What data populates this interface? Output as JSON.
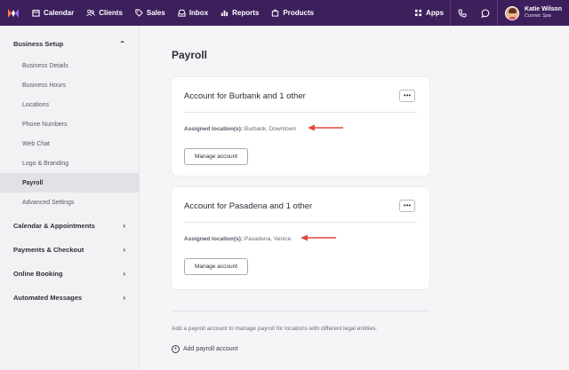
{
  "nav": {
    "items": [
      {
        "label": "Calendar",
        "icon": "calendar-icon"
      },
      {
        "label": "Clients",
        "icon": "users-icon"
      },
      {
        "label": "Sales",
        "icon": "tag-icon"
      },
      {
        "label": "Inbox",
        "icon": "inbox-icon"
      },
      {
        "label": "Reports",
        "icon": "bar-chart-icon"
      },
      {
        "label": "Products",
        "icon": "bag-icon"
      }
    ],
    "apps_label": "Apps",
    "user": {
      "name": "Katie Wilson",
      "org": "Cosmic Spa"
    }
  },
  "sidebar": {
    "business_setup": {
      "label": "Business Setup",
      "items": [
        "Business Details",
        "Business Hours",
        "Locations",
        "Phone Numbers",
        "Web Chat",
        "Logo & Branding",
        "Payroll",
        "Advanced Settings"
      ],
      "active": "Payroll"
    },
    "sections": [
      "Calendar & Appointments",
      "Payments & Checkout",
      "Online Booking",
      "Automated Messages"
    ]
  },
  "page": {
    "title": "Payroll",
    "accounts": [
      {
        "title": "Account for Burbank and 1 other",
        "assigned_label": "Assigned location(s):",
        "locations": "Burbank, Downtown",
        "button": "Manage account"
      },
      {
        "title": "Account for Pasadena and 1 other",
        "assigned_label": "Assigned location(s):",
        "locations": "Pasadena, Venice",
        "button": "Manage account"
      }
    ],
    "help_text": "Add a payroll account to manage payroll for locations with different legal entities.",
    "add_label": "Add payroll account",
    "more_label": "•••"
  },
  "colors": {
    "nav_bg": "#3c1f5b",
    "arrow": "#e0483c",
    "logo_orange": "#ff7a45"
  }
}
